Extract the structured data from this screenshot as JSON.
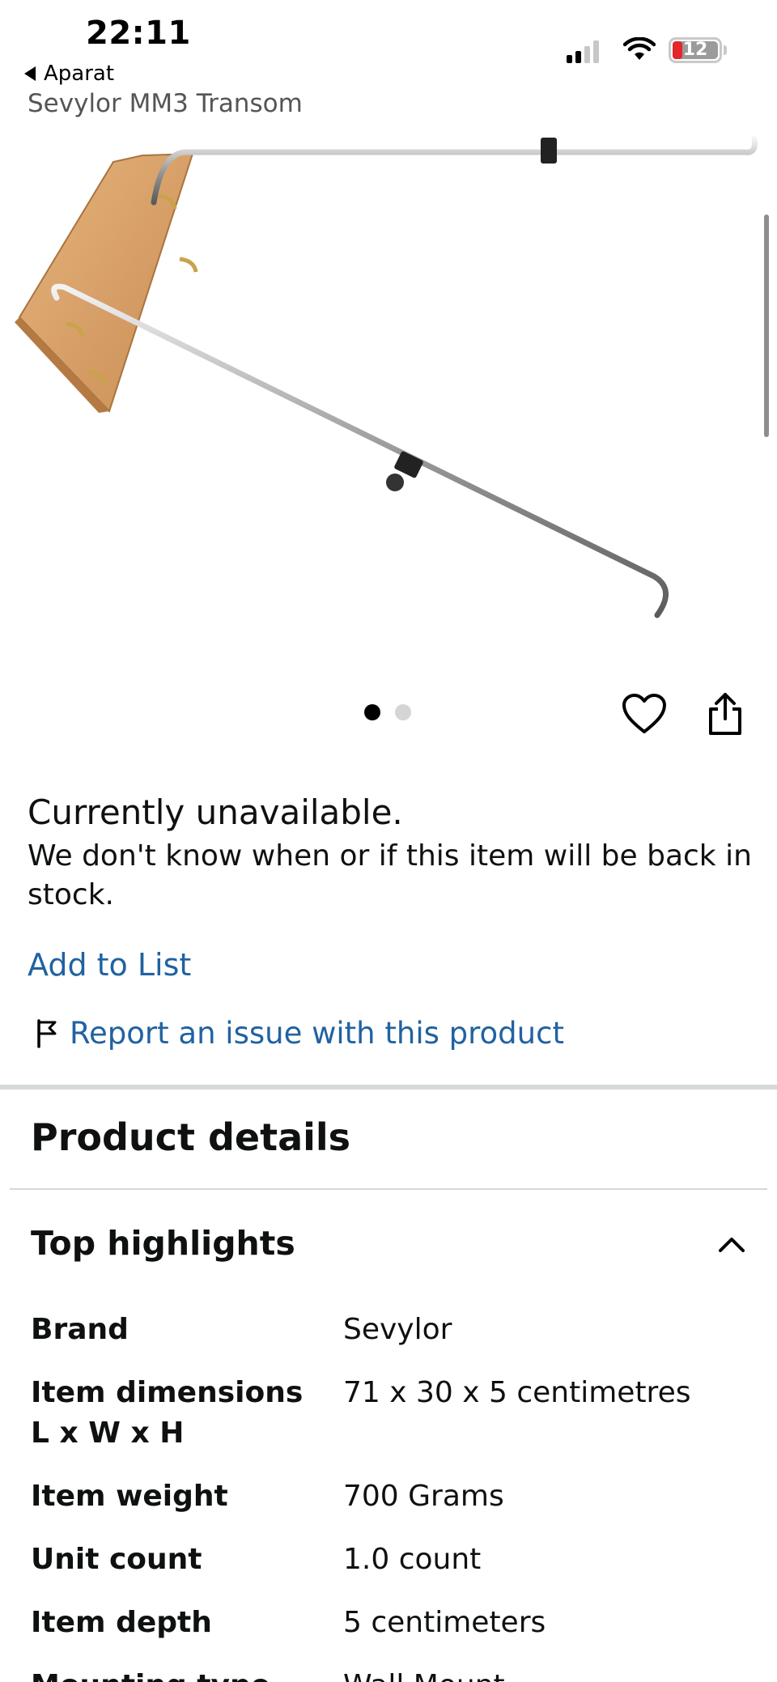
{
  "status_bar": {
    "time": "22:11",
    "back_label": "Aparat",
    "battery": "12"
  },
  "page": {
    "title": "Sevylor MM3 Transom"
  },
  "image_controls": {
    "total_images": 2,
    "active_index": 0,
    "wishlist_icon": "heart-icon",
    "share_icon": "share-icon"
  },
  "availability": {
    "status": "Currently unavailable.",
    "description": "We don't know when or if this item will be back in stock."
  },
  "actions": {
    "add_to_list": "Add to List",
    "report_issue": "Report an issue with this product"
  },
  "product_details": {
    "heading": "Product details",
    "top_highlights": {
      "heading": "Top highlights",
      "expanded": true,
      "rows": [
        {
          "key": "Brand",
          "value": "Sevylor"
        },
        {
          "key": "Item dimensions L x W x H",
          "value": "71 x 30 x 5 centimetres"
        },
        {
          "key": "Item weight",
          "value": "700 Grams"
        },
        {
          "key": "Unit count",
          "value": "1.0 count"
        },
        {
          "key": "Item depth",
          "value": "5 centimeters"
        },
        {
          "key": "Mounting type",
          "value": "Wall Mount"
        }
      ]
    }
  },
  "colors": {
    "link": "#2162a1",
    "text": "#0f1111",
    "divider": "#d5d9d9"
  }
}
